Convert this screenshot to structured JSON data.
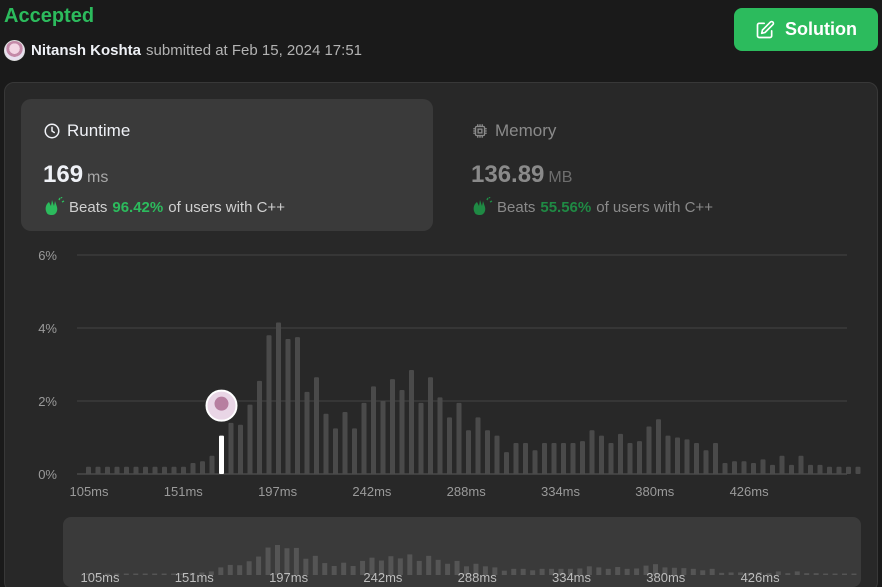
{
  "status": "Accepted",
  "submitter": {
    "name": "Nitansh Koshta",
    "submitted_text": "submitted at Feb 15, 2024 17:51"
  },
  "solution_button": {
    "label": "Solution"
  },
  "runtime": {
    "title": "Runtime",
    "value": "169",
    "unit": "ms",
    "beats_word": "Beats",
    "beats_pct": "96.42%",
    "beats_suffix": "of users with C++"
  },
  "memory": {
    "title": "Memory",
    "value": "136.89",
    "unit": "MB",
    "beats_word": "Beats",
    "beats_pct": "55.56%",
    "beats_suffix": "of users with C++"
  },
  "colors": {
    "accent": "#2cbb5d",
    "bar": "#4a4a4a",
    "highlight_bar": "#ffffff"
  },
  "chart_data": {
    "type": "bar",
    "title": "",
    "xlabel": "",
    "ylabel": "",
    "ylim": [
      0,
      6
    ],
    "y_ticks": [
      "0%",
      "2%",
      "4%",
      "6%"
    ],
    "x_ticks": [
      "105ms",
      "151ms",
      "197ms",
      "242ms",
      "288ms",
      "334ms",
      "380ms",
      "426ms"
    ],
    "grid": true,
    "highlight_index": 14,
    "values": [
      0.2,
      0.2,
      0.2,
      0.2,
      0.2,
      0.2,
      0.2,
      0.2,
      0.2,
      0.2,
      0.2,
      0.3,
      0.35,
      0.5,
      1.05,
      1.4,
      1.35,
      1.9,
      2.55,
      3.8,
      4.15,
      3.7,
      3.75,
      2.25,
      2.65,
      1.65,
      1.25,
      1.7,
      1.25,
      1.95,
      2.4,
      2.0,
      2.6,
      2.3,
      2.85,
      1.95,
      2.65,
      2.1,
      1.55,
      1.95,
      1.2,
      1.55,
      1.2,
      1.05,
      0.6,
      0.85,
      0.85,
      0.65,
      0.85,
      0.85,
      0.85,
      0.85,
      0.9,
      1.2,
      1.05,
      0.85,
      1.1,
      0.85,
      0.9,
      1.3,
      1.5,
      1.05,
      1.0,
      0.95,
      0.85,
      0.65,
      0.85,
      0.3,
      0.35,
      0.35,
      0.3,
      0.4,
      0.25,
      0.5,
      0.25,
      0.5,
      0.25,
      0.25,
      0.2,
      0.2,
      0.2,
      0.2
    ]
  }
}
